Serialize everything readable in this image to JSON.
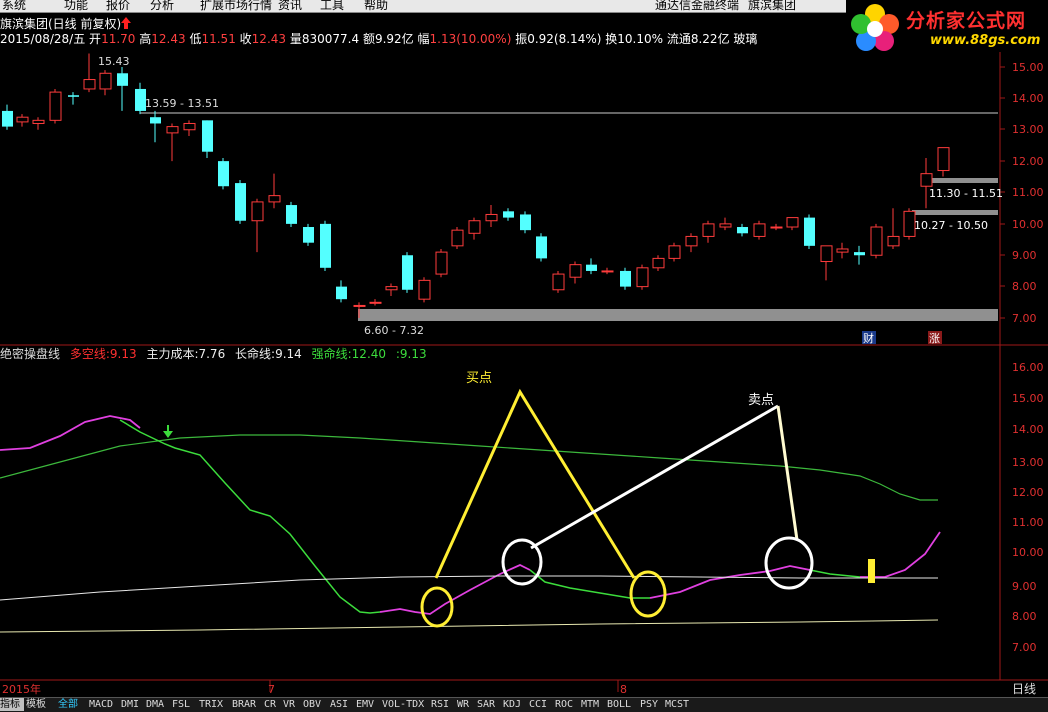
{
  "menu": [
    "系统",
    "功能",
    "报价",
    "分析",
    "扩展市场行情",
    "资讯",
    "工具",
    "帮助",
    "通达信金融终端",
    "旗滨集团"
  ],
  "logo": {
    "title": "分析家公式网",
    "url": "www.88gs.com"
  },
  "header": {
    "stock_title": "旗滨集团(日线 前复权)",
    "date": "2015/08/28/五",
    "open_label": "开",
    "open": "11.70",
    "high_label": "高",
    "high": "12.43",
    "low_label": "低",
    "low": "11.51",
    "close_label": "收",
    "close": "12.43",
    "volume": "量830077.4",
    "amount": "额9.92亿",
    "change_label": "幅",
    "change": "1.13(10.00%)",
    "amplitude": "振0.92(8.14%)",
    "turnover": "换10.10%",
    "float_shares": "流通8.22亿",
    "sector": "玻璃"
  },
  "price_axis": [
    "15.00",
    "14.00",
    "13.00",
    "12.00",
    "11.00",
    "10.00",
    "9.00",
    "8.00",
    "7.00"
  ],
  "price_annotations": {
    "high_mark": "15.43",
    "range1": "13.59 - 13.51",
    "low_mark": "6.60 - 7.32",
    "range2": "11.30 - 11.51",
    "range3": "10.27 - 10.50",
    "tag_fin": "财",
    "tag_up": "涨"
  },
  "indicator": {
    "name": "绝密操盘线",
    "items": [
      {
        "label": "多空线:",
        "value": "9.13",
        "color": "#ff3030"
      },
      {
        "label": "主力成本:",
        "value": "7.76",
        "color": "#eeeeee"
      },
      {
        "label": "长命线:",
        "value": "9.14",
        "color": "#eeeeee"
      },
      {
        "label": "强命线:",
        "value": "12.40",
        "color": "#3cdc3c"
      },
      {
        "label": ":",
        "value": "9.13",
        "color": "#3cdc3c"
      }
    ]
  },
  "indicator_axis": [
    "16.00",
    "15.00",
    "14.00",
    "13.00",
    "12.00",
    "11.00",
    "10.00",
    "9.00",
    "8.00",
    "7.00"
  ],
  "annotations": {
    "buy": "买点",
    "sell": "卖点"
  },
  "date_axis": {
    "year": "2015年",
    "m7": "7",
    "m8": "8",
    "period": "日线"
  },
  "tabs": [
    "指标",
    "模板",
    "全部",
    "MACD",
    "DMI",
    "DMA",
    "FSL",
    "TRIX",
    "BRAR",
    "CR",
    "VR",
    "OBV",
    "ASI",
    "EMV",
    "VOL-TDX",
    "RSI",
    "WR",
    "SAR",
    "KDJ",
    "CCI",
    "ROC",
    "MTM",
    "BOLL",
    "PSY",
    "MCST"
  ],
  "colors": {
    "up": "#ff3c3c",
    "down": "#54ffff",
    "buy": "#ffee33",
    "sell": "#ffffff",
    "strong": "#3cdc3c",
    "magenta": "#e040e0"
  }
}
